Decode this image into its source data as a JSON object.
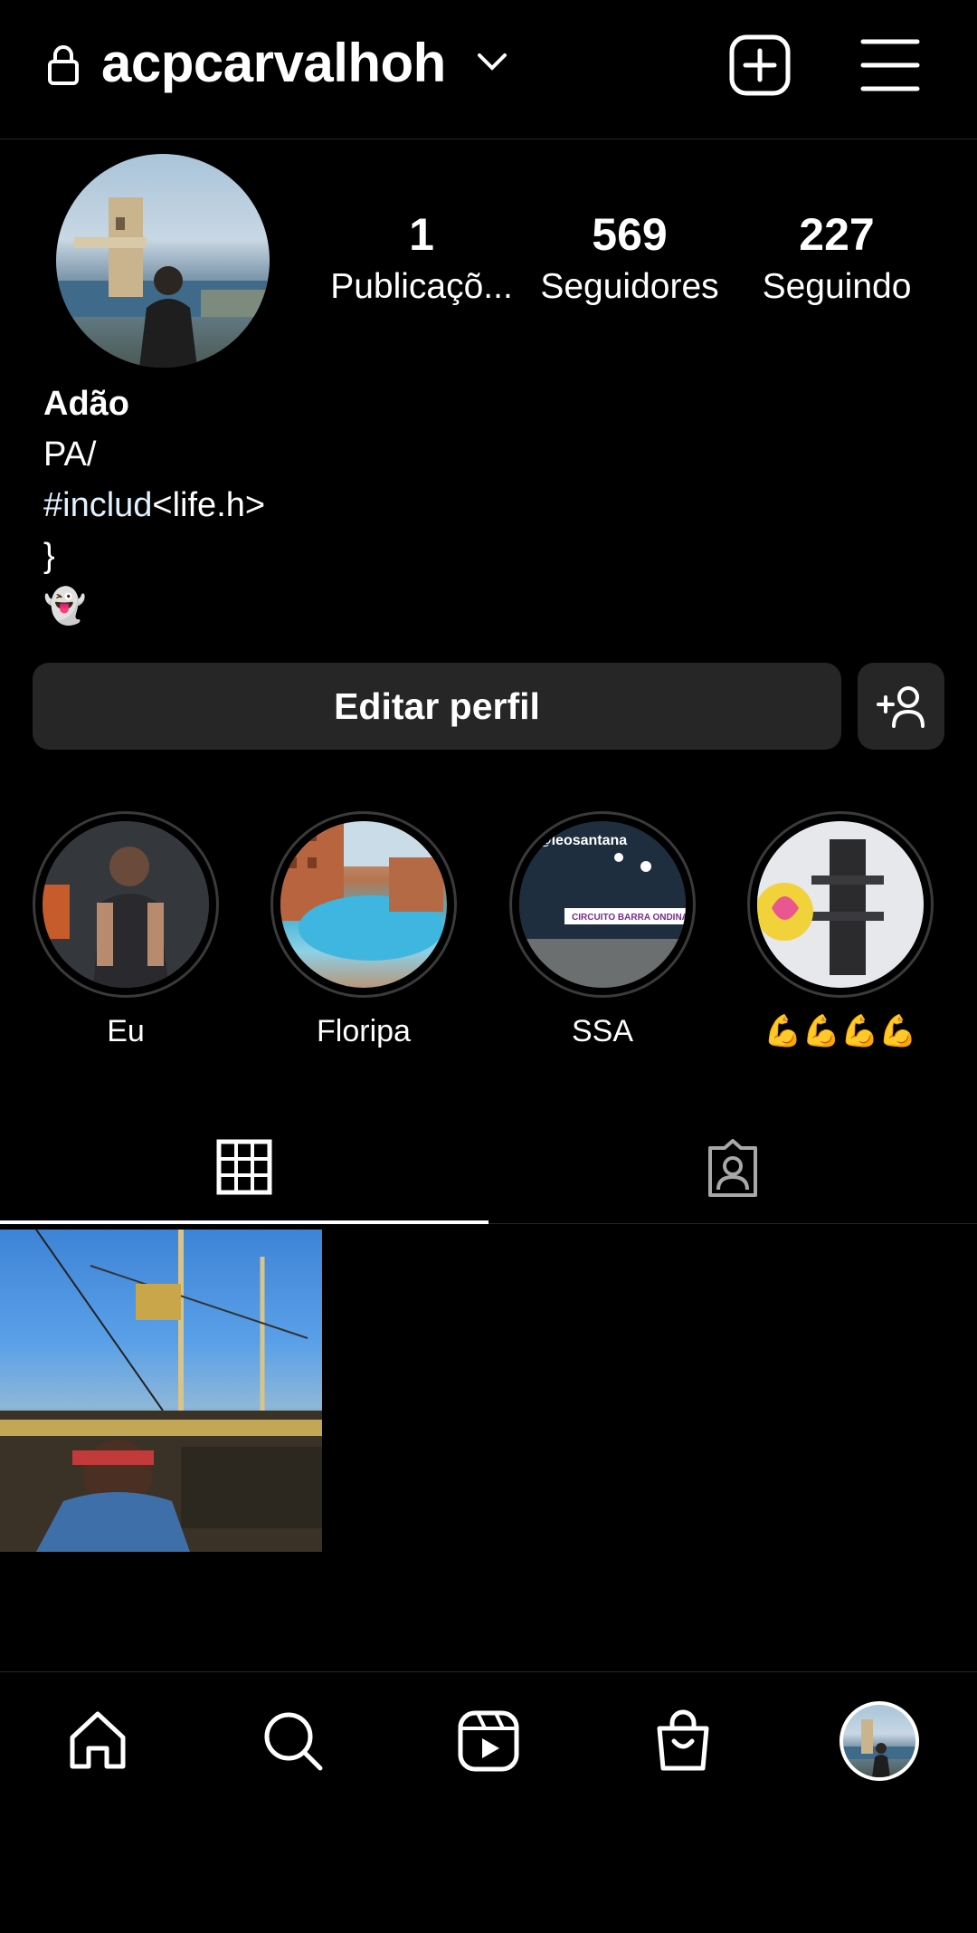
{
  "header": {
    "username": "acpcarvalhoh",
    "icons": {
      "lock": "lock-icon",
      "dropdown": "chevron-down-icon",
      "new_post": "plus-square-icon",
      "menu": "hamburger-menu-icon"
    }
  },
  "profile": {
    "stats": [
      {
        "value": "1",
        "label": "Publicaçõ..."
      },
      {
        "value": "569",
        "label": "Seguidores"
      },
      {
        "value": "227",
        "label": "Seguindo"
      }
    ],
    "bio": {
      "name": "Adão",
      "line1": "PA/",
      "line2_hash": "#includ",
      "line2_rest": "<life.h>",
      "line3": "}",
      "line4": "👻"
    },
    "edit_button": "Editar perfil",
    "discover_people_icon": "add-person-icon"
  },
  "highlights": [
    {
      "label": "Eu"
    },
    {
      "label": "Floripa"
    },
    {
      "label": "SSA",
      "overlay_text": "@leosantana",
      "banner_text": "CIRCUITO BARRA ONDINA"
    },
    {
      "label": "💪💪💪💪"
    }
  ],
  "tabs": {
    "active": "grid",
    "items": [
      "grid-icon",
      "tagged-icon"
    ]
  },
  "nav": [
    "home-icon",
    "search-icon",
    "reels-icon",
    "shop-icon",
    "profile-avatar"
  ],
  "colors": {
    "background": "#000000",
    "button": "#262626",
    "divider": "#262626",
    "text": "#ffffff"
  }
}
